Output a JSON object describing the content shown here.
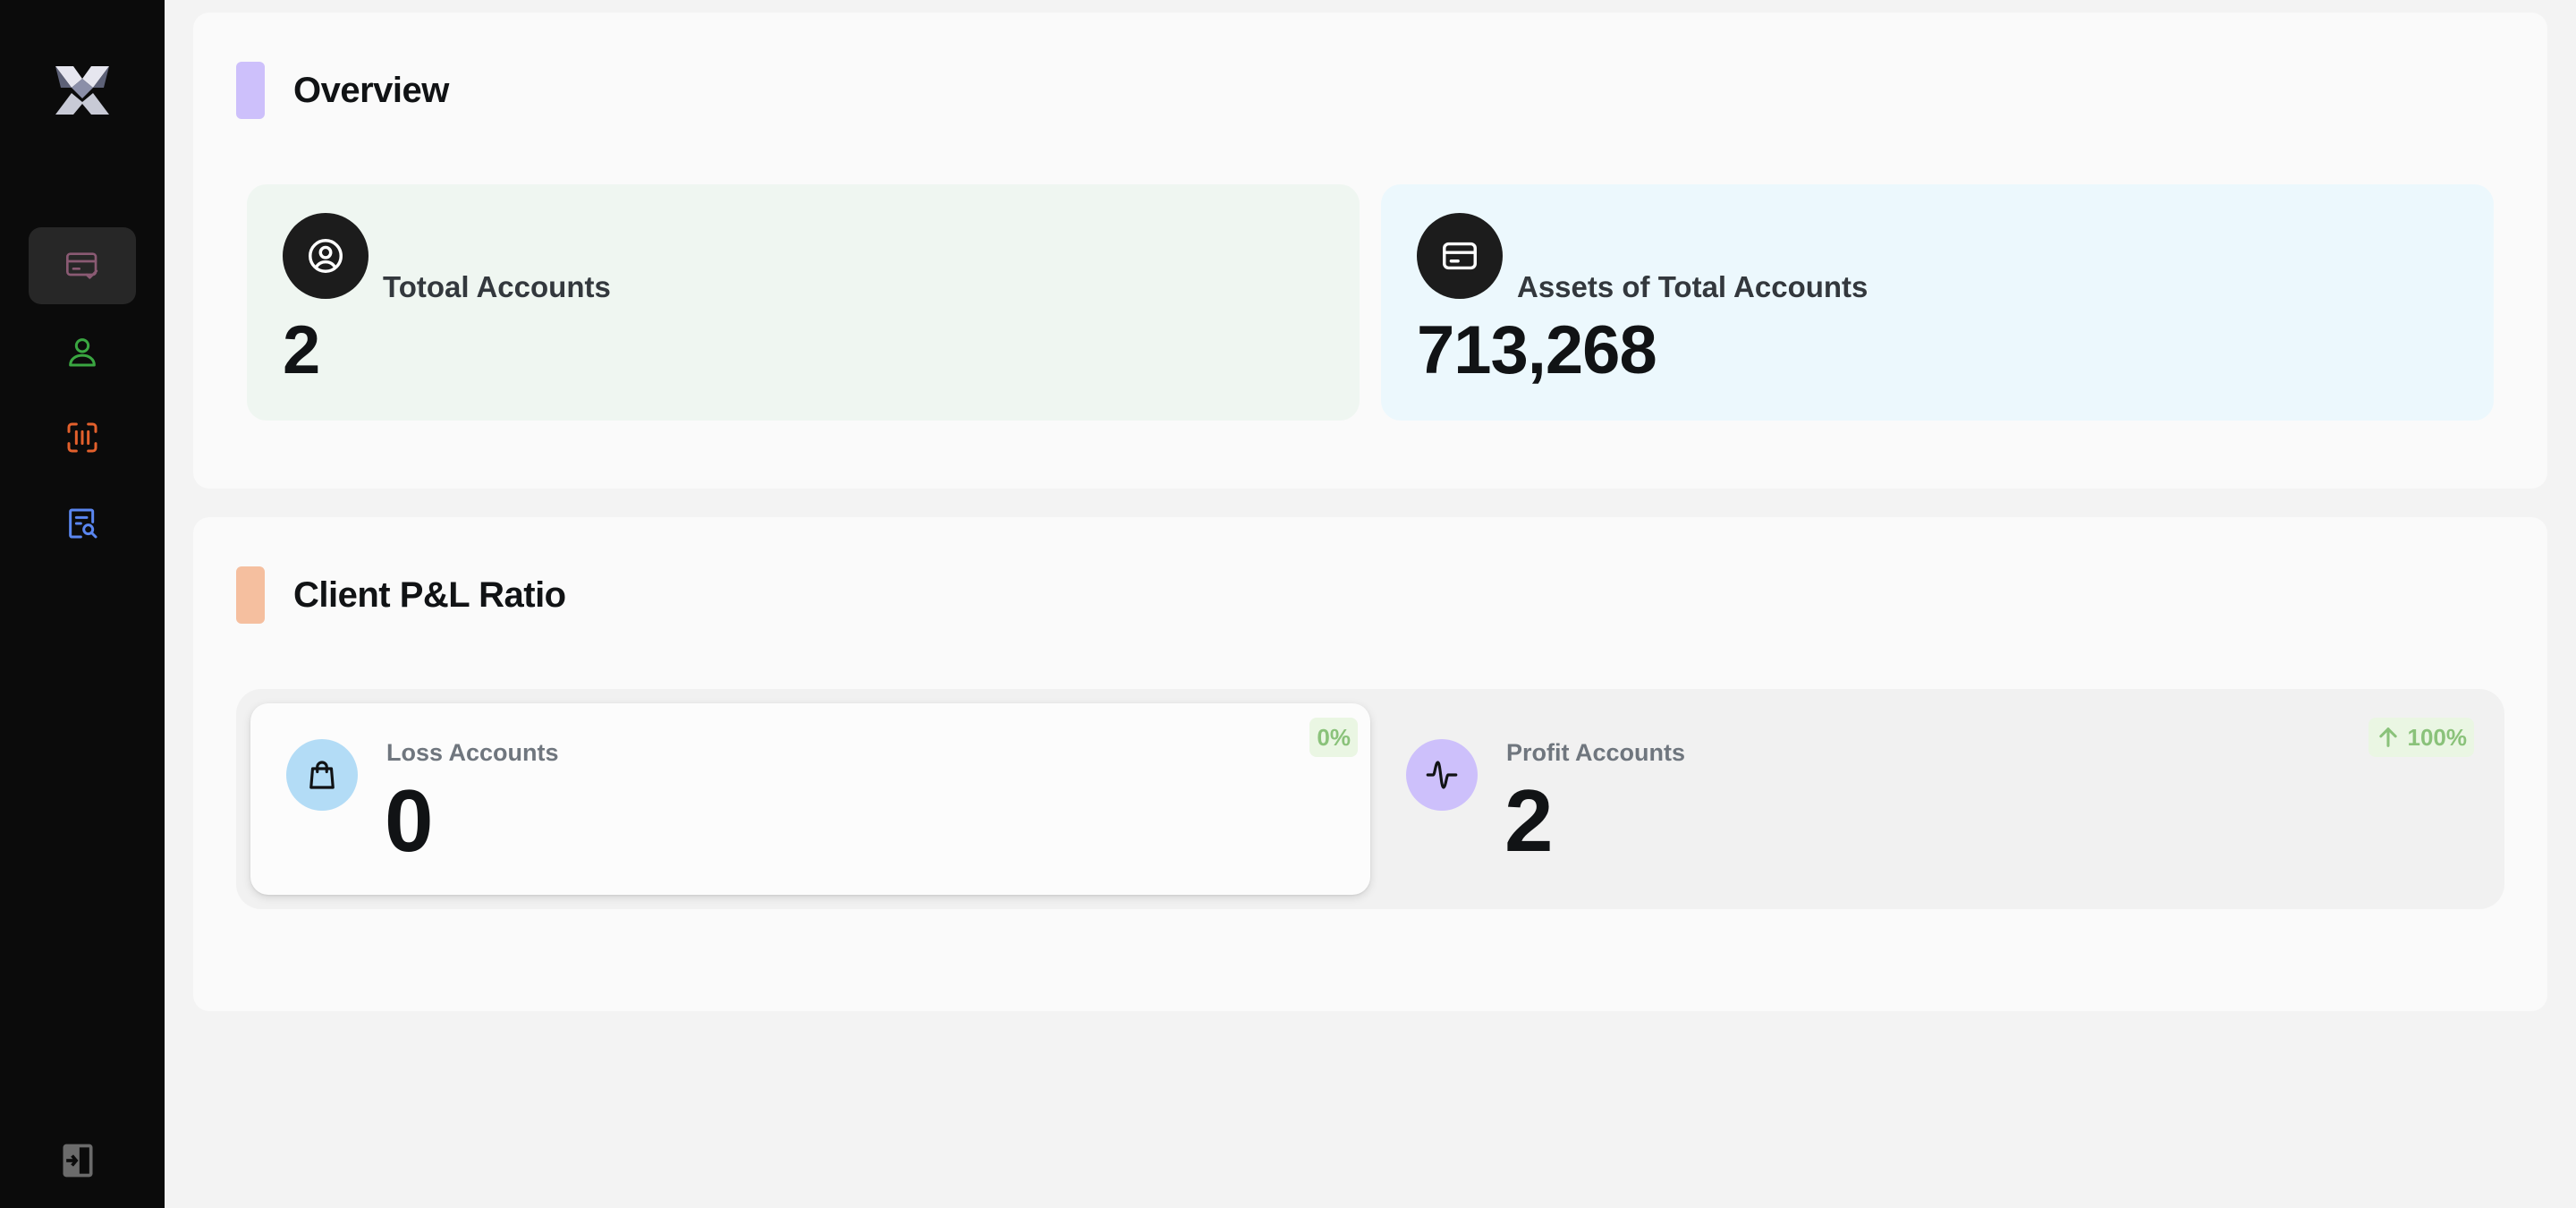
{
  "sidebar": {
    "logo_icon": "brand-logo-icon",
    "items": [
      {
        "icon": "card-check-icon",
        "active": true,
        "color": "#8a5a73"
      },
      {
        "icon": "user-icon",
        "active": false,
        "color": "#3aa641"
      },
      {
        "icon": "scan-icon",
        "active": false,
        "color": "#e3602c"
      },
      {
        "icon": "document-search-icon",
        "active": false,
        "color": "#5a86f0"
      }
    ],
    "bottom_icon": "login-icon"
  },
  "overview": {
    "title": "Overview",
    "marker_color": "#cdc0fb",
    "cards": [
      {
        "label": "Totoal Accounts",
        "value": "2",
        "icon": "user-circle-icon",
        "background": "#eff6f1"
      },
      {
        "label": "Assets of Total Accounts",
        "value": "713,268",
        "icon": "credit-card-icon",
        "background": "#ecf8fd"
      }
    ]
  },
  "pl_ratio": {
    "title": "Client P&L Ratio",
    "marker_color": "#f5bf9f",
    "cards": [
      {
        "label": "Loss Accounts",
        "value": "0",
        "badge": "0%",
        "icon": "shopping-bag-icon",
        "icon_background": "#b3dcf6"
      },
      {
        "label": "Profit Accounts",
        "value": "2",
        "badge": "100%",
        "badge_icon": "arrow-up-icon",
        "icon": "activity-icon",
        "icon_background": "#cdc0fb"
      }
    ],
    "badge_color": "#8ac27a"
  }
}
